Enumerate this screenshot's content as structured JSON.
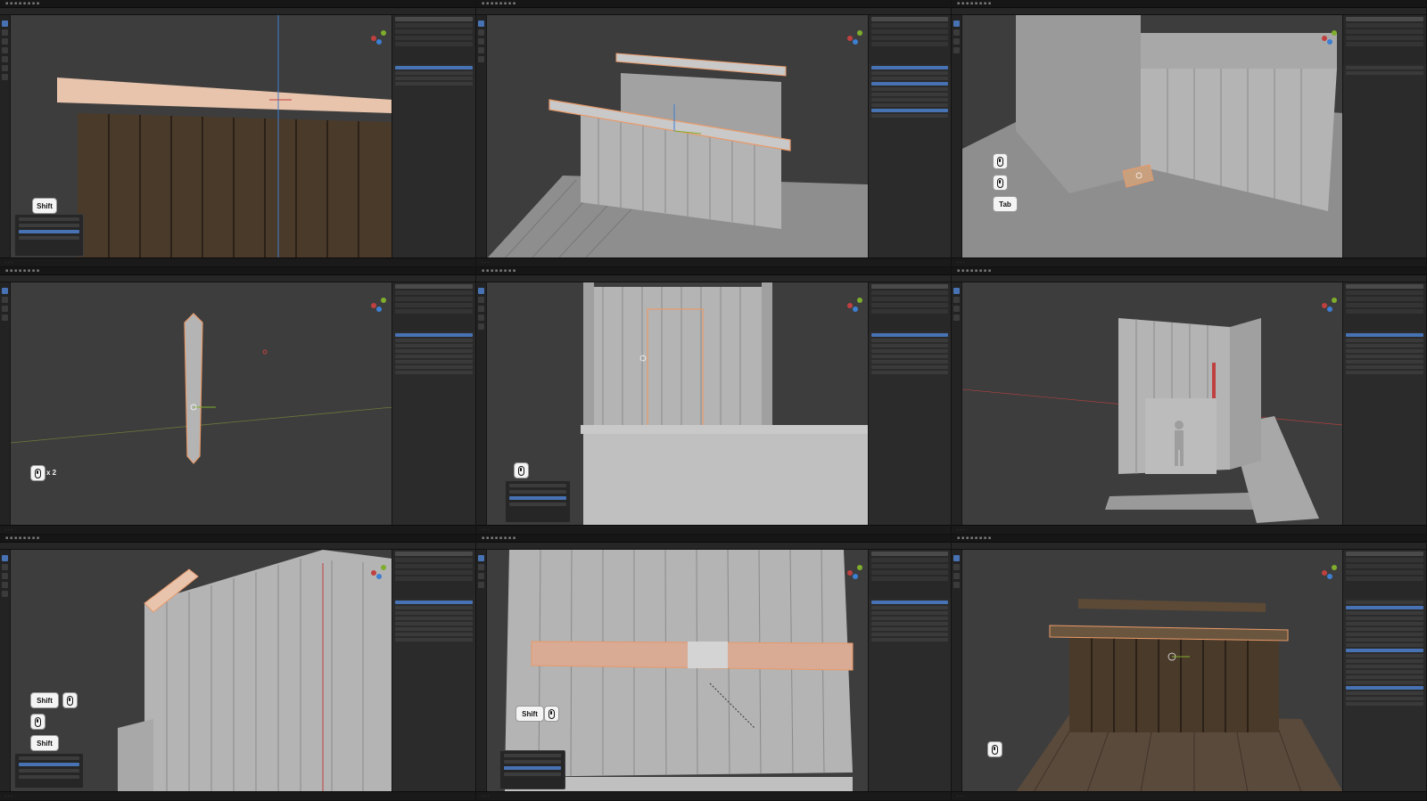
{
  "keys": {
    "shift": "Shift",
    "tab": "Tab",
    "times_two": "x 2"
  },
  "colors": {
    "viewport_bg": "#3d3d3d",
    "wood_dark": "#4a3a2a",
    "plank_grey": "#b4b4b4",
    "selection_orange": "#e89a6a",
    "active_blue": "#4772b3",
    "axis_x": "#c04040",
    "axis_y": "#7fae2c",
    "axis_z": "#3d7fd2"
  },
  "icons": [
    "mouse-left-icon",
    "mouse-middle-icon",
    "mouse-right-icon"
  ]
}
